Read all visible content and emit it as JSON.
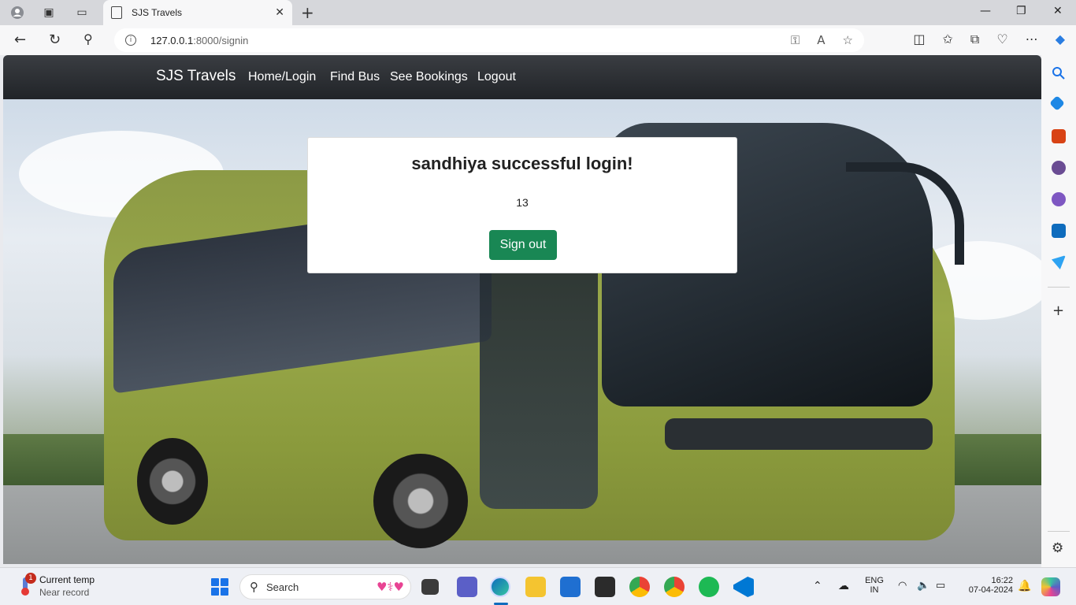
{
  "browser": {
    "tab_title": "SJS Travels",
    "url_host": "127.0.0.1",
    "url_rest": ":8000/signin"
  },
  "site": {
    "brand": "SJS Travels",
    "nav": [
      "Home/Login",
      "Find Bus",
      "See Bookings",
      "Logout"
    ]
  },
  "card": {
    "message": "sandhiya successful login!",
    "value": "13",
    "signout_label": "Sign out"
  },
  "taskbar": {
    "weather_title": "Current temp",
    "weather_sub": "Near record",
    "weather_badge": "1",
    "search_label": "Search",
    "lang_top": "ENG",
    "lang_bottom": "IN",
    "time": "16:22",
    "date": "07-04-2024"
  },
  "colors": {
    "nav_bg": "#212428",
    "signout_bg": "#198754",
    "card_bg": "#ffffff"
  }
}
